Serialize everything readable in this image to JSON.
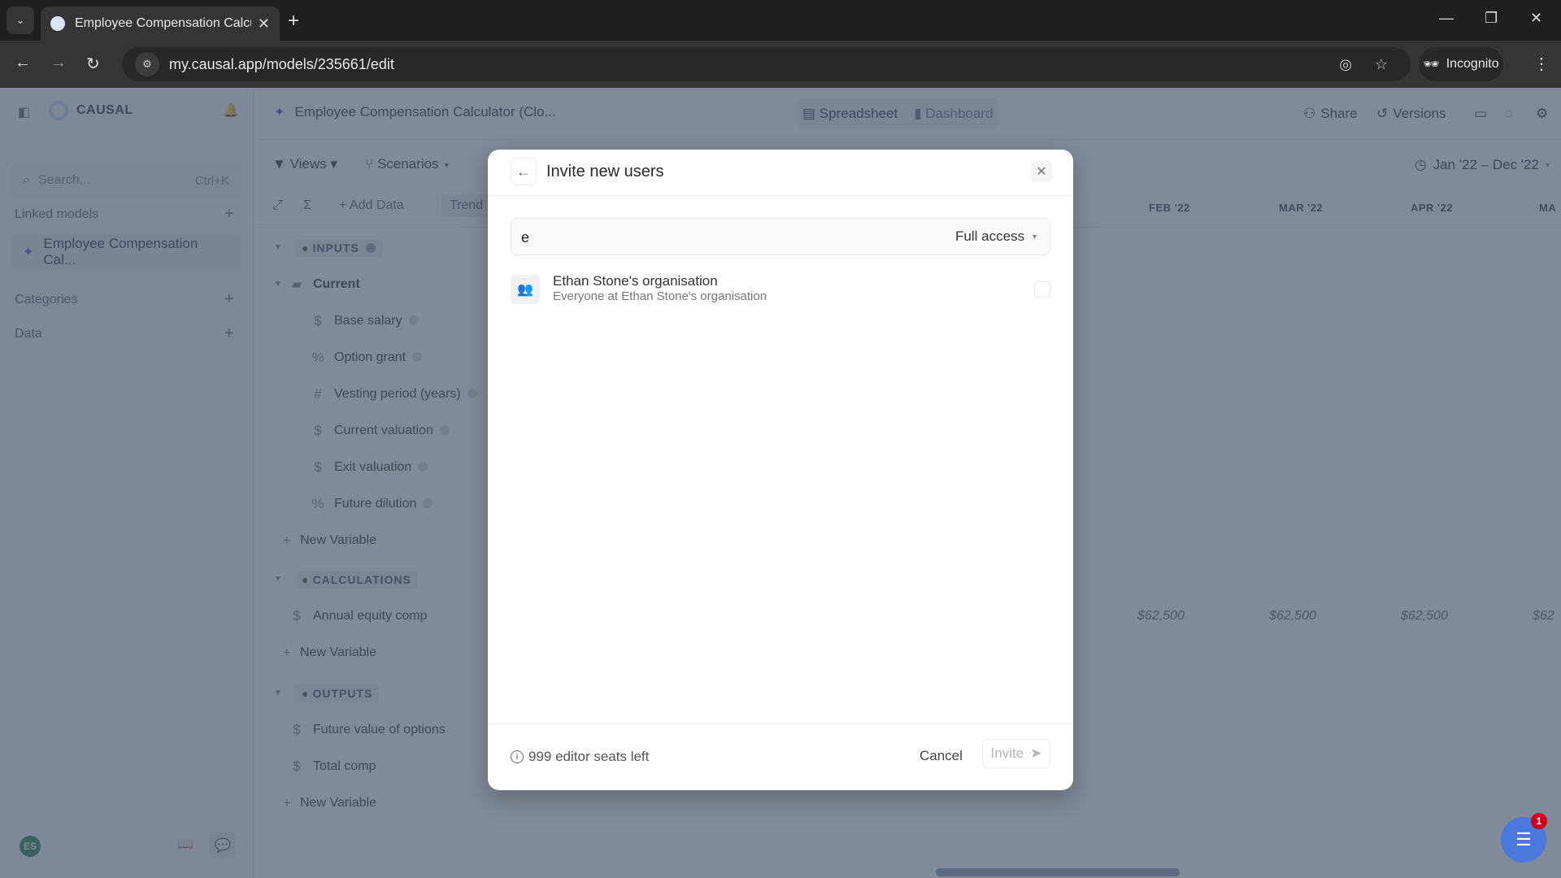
{
  "browser": {
    "tab_title": "Employee Compensation Calcul",
    "url": "my.causal.app/models/235661/edit",
    "incognito_label": "Incognito"
  },
  "sidebar": {
    "brand": "CAUSAL",
    "search_placeholder": "Search...",
    "search_shortcut": "Ctrl+K",
    "linked_models_label": "Linked models",
    "linked_models": [
      "Employee Compensation Cal..."
    ],
    "categories_label": "Categories",
    "data_label": "Data",
    "avatar_initials": "ES"
  },
  "header": {
    "model_title": "Employee Compensation Calculator (Clo...",
    "view_tabs": [
      "Spreadsheet",
      "Dashboard"
    ],
    "share_label": "Share",
    "versions_label": "Versions"
  },
  "toolbar": {
    "views_label": "Views",
    "scenarios_label": "Scenarios",
    "add_data_label": "Add Data",
    "trend_label": "Trend",
    "date_range": "Jan '22 – Dec '22"
  },
  "columns": [
    "FEB '22",
    "MAR '22",
    "APR '22",
    "MA"
  ],
  "sections": {
    "inputs": {
      "label": "INPUTS",
      "group": "Current",
      "variables": [
        {
          "icon": "$",
          "name": "Base salary"
        },
        {
          "icon": "%",
          "name": "Option grant"
        },
        {
          "icon": "#",
          "name": "Vesting period (years)"
        },
        {
          "icon": "$",
          "name": "Current valuation"
        },
        {
          "icon": "$",
          "name": "Exit valuation"
        },
        {
          "icon": "%",
          "name": "Future dilution"
        }
      ]
    },
    "calculations": {
      "label": "CALCULATIONS",
      "variables": [
        {
          "icon": "$",
          "name": "Annual equity comp",
          "values": [
            "$62,500",
            "$62,500",
            "$62,500",
            "$62"
          ]
        }
      ]
    },
    "outputs": {
      "label": "OUTPUTS",
      "variables": [
        {
          "icon": "$",
          "name": "Future value of options"
        },
        {
          "icon": "$",
          "name": "Total comp"
        }
      ]
    },
    "new_variable_label": "New Variable"
  },
  "modal": {
    "title": "Invite new users",
    "input_value": "e",
    "access_level": "Full access",
    "suggestion": {
      "name": "Ethan Stone's organisation",
      "description": "Everyone at Ethan Stone's organisation"
    },
    "seats_text": "999 editor seats left",
    "cancel_label": "Cancel",
    "invite_label": "Invite"
  },
  "chat_badge_count": "1"
}
